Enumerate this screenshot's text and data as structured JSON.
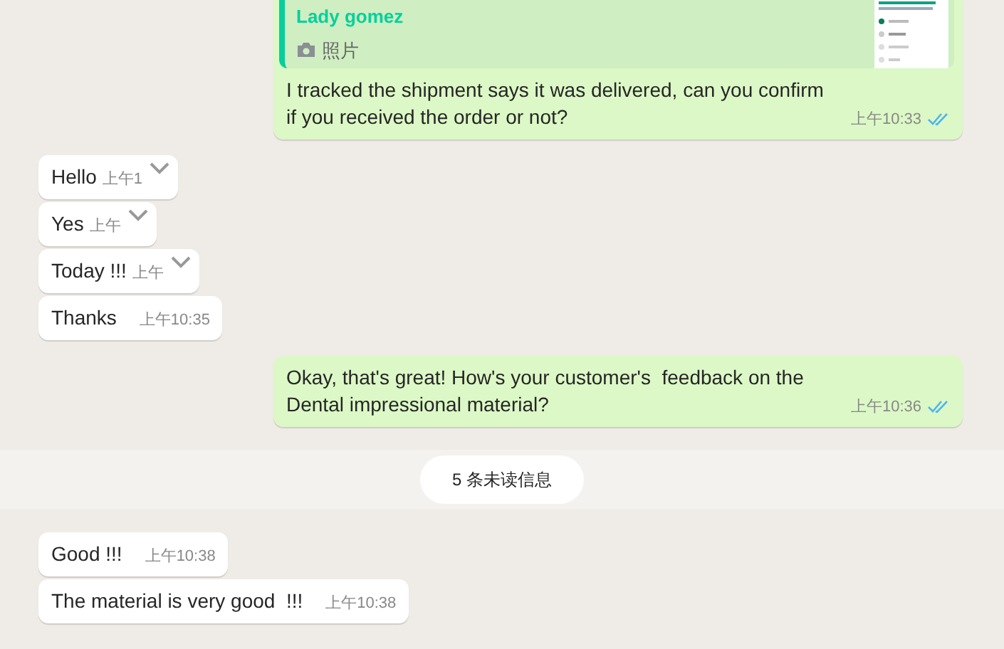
{
  "messages": [
    {
      "kind": "out",
      "quote": {
        "author": "Lady gomez",
        "media_label": "照片",
        "kind": "picture"
      },
      "text": "I tracked the shipment says it was delivered, can you confirm if you received the order or not?",
      "time": "上午10:33",
      "read": true
    },
    {
      "kind": "in",
      "text": "Hello",
      "time": "上午1",
      "menu_caret": true
    },
    {
      "kind": "in",
      "text": "Yes",
      "time": "上午",
      "menu_caret": true
    },
    {
      "kind": "in",
      "text": "Today !!!",
      "time": "上午",
      "menu_caret": true
    },
    {
      "kind": "in",
      "text": "Thanks",
      "time": "上午10:35",
      "menu_caret": false
    },
    {
      "kind": "out",
      "text": "Okay, that's great! How's your customer's  feedback on the Dental impressional material?",
      "time": "上午10:36",
      "read": true
    },
    {
      "kind": "divider",
      "text": "5 条未读信息"
    },
    {
      "kind": "in",
      "text": "Good !!!",
      "time": "上午10:38",
      "menu_caret": false
    },
    {
      "kind": "in",
      "text": "The material is very good  !!!",
      "time": "上午10:38",
      "menu_caret": false
    }
  ]
}
